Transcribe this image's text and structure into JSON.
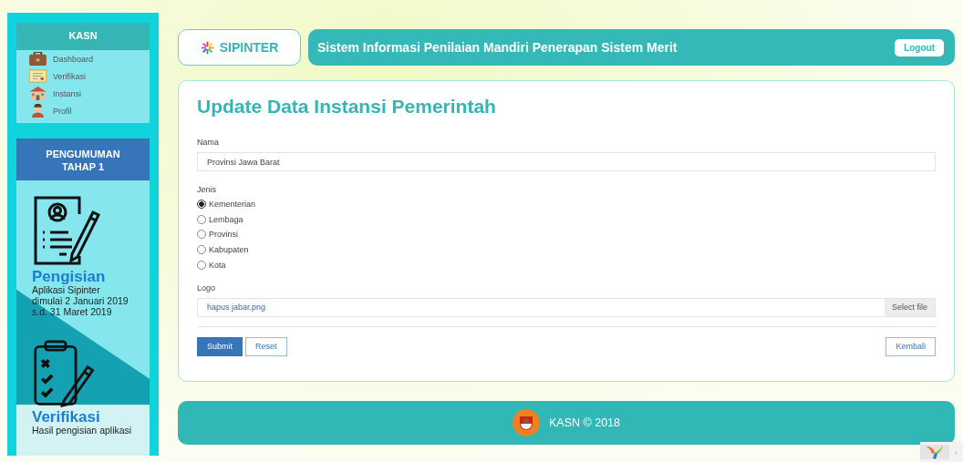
{
  "sidebar": {
    "title": "KASN",
    "menu": [
      {
        "label": "Dashboard",
        "kind": "briefcase"
      },
      {
        "label": "Verifikasi",
        "kind": "certificate"
      },
      {
        "label": "Instansi",
        "kind": "building"
      },
      {
        "label": "Profil",
        "kind": "person"
      }
    ],
    "announcement": {
      "title": "PENGUMUMAN",
      "subtitle": "TAHAP 1",
      "items": [
        {
          "kind": "form",
          "heading": "Pengisian",
          "lines": [
            "Aplikasi Sipinter",
            "dimulai 2 Januari 2019",
            "s.d. 31 Maret 2019"
          ]
        },
        {
          "kind": "checklist",
          "heading": "Verifikasi",
          "lines": [
            "Hasil pengisian aplikasi"
          ]
        }
      ]
    }
  },
  "header": {
    "brand": "SIPINTER",
    "title": "Sistem Informasi Penilaian Mandiri Penerapan Sistem Merit",
    "logout": "Logout"
  },
  "form": {
    "title": "Update Data Instansi Pemerintah",
    "name_label": "Nama",
    "name_value": "Provinsi Jawa Barat",
    "type_label": "Jenis",
    "types": [
      {
        "label": "Kementerian",
        "selected": true
      },
      {
        "label": "Lembaga",
        "selected": false
      },
      {
        "label": "Provinsi",
        "selected": false
      },
      {
        "label": "Kabupaten",
        "selected": false
      },
      {
        "label": "Kota",
        "selected": false
      }
    ],
    "logo_label": "Logo",
    "logo_value": "hapus jabar.png",
    "select_file": "Select file",
    "submit": "Submit",
    "reset": "Reset",
    "back": "Kembali"
  },
  "footer": {
    "text": "KASN © 2018"
  },
  "debug_toggle": "‹"
}
